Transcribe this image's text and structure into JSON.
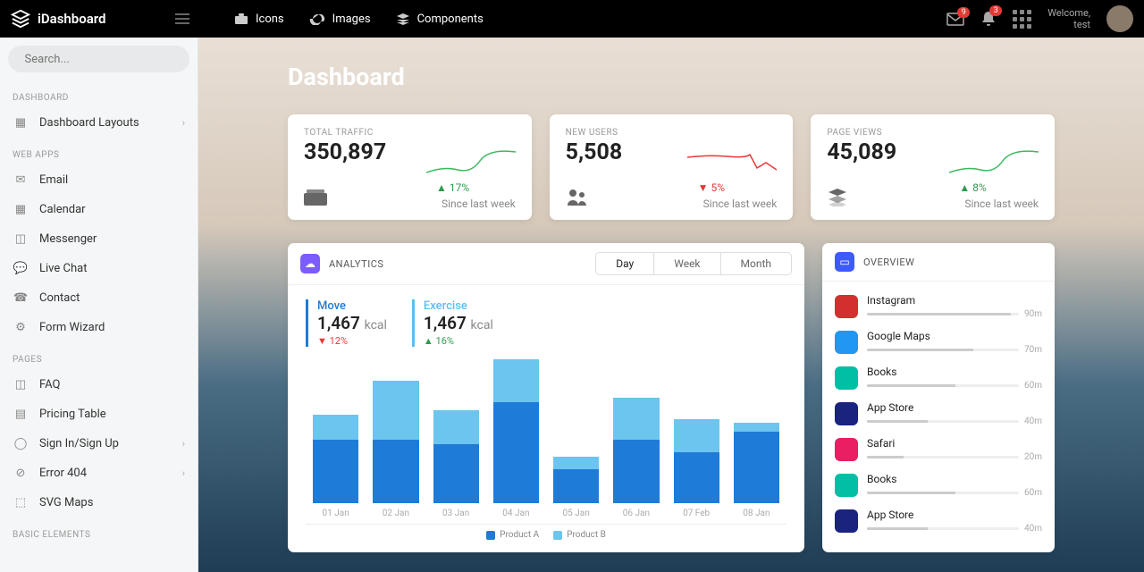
{
  "brand": "iDashboard",
  "topnav": {
    "icons": "Icons",
    "images": "Images",
    "components": "Components"
  },
  "badges": {
    "mail": "9",
    "bell": "3"
  },
  "welcome": {
    "line1": "Welcome,",
    "line2": "test"
  },
  "search": {
    "placeholder": "Search..."
  },
  "sidebar": {
    "sections": {
      "dashboard": "DASHBOARD",
      "webapps": "WEB APPS",
      "pages": "PAGES",
      "basic": "BASIC ELEMENTS"
    },
    "items": {
      "layouts": "Dashboard Layouts",
      "email": "Email",
      "calendar": "Calendar",
      "messenger": "Messenger",
      "livechat": "Live Chat",
      "contact": "Contact",
      "formwizard": "Form Wizard",
      "faq": "FAQ",
      "pricing": "Pricing Table",
      "sign": "Sign In/Sign Up",
      "error": "Error 404",
      "svgmaps": "SVG Maps"
    }
  },
  "page_title": "Dashboard",
  "stats": [
    {
      "label": "TOTAL TRAFFIC",
      "value": "350,897",
      "change": "17%",
      "dir": "up",
      "since": "Since last week"
    },
    {
      "label": "NEW USERS",
      "value": "5,508",
      "change": "5%",
      "dir": "down",
      "since": "Since last week"
    },
    {
      "label": "PAGE VIEWS",
      "value": "45,089",
      "change": "8%",
      "dir": "up",
      "since": "Since last week"
    }
  ],
  "analytics": {
    "title": "ANALYTICS",
    "tabs": [
      "Day",
      "Week",
      "Month"
    ],
    "metrics": [
      {
        "label": "Move",
        "value": "1,467",
        "unit": "kcal",
        "change": "12%",
        "dir": "down"
      },
      {
        "label": "Exercise",
        "value": "1,467",
        "unit": "kcal",
        "change": "16%",
        "dir": "up"
      }
    ],
    "legend": [
      "Product A",
      "Product B"
    ]
  },
  "chart_data": {
    "type": "bar",
    "categories": [
      "01 Jan",
      "02 Jan",
      "03 Jan",
      "04 Jan",
      "05 Jan",
      "06 Jan",
      "07 Feb",
      "08 Jan"
    ],
    "series": [
      {
        "name": "Product A",
        "values": [
          75,
          75,
          70,
          120,
          40,
          75,
          60,
          85
        ]
      },
      {
        "name": "Product B",
        "values": [
          30,
          70,
          40,
          50,
          15,
          50,
          40,
          10
        ]
      }
    ],
    "ylim": [
      0,
      180
    ]
  },
  "overview": {
    "title": "OVERVIEW",
    "items": [
      {
        "name": "Instagram",
        "time": "90m",
        "pct": 95,
        "color": "#d32f2f"
      },
      {
        "name": "Google Maps",
        "time": "70m",
        "pct": 70,
        "color": "#2196f3"
      },
      {
        "name": "Books",
        "time": "60m",
        "pct": 58,
        "color": "#00bfa5"
      },
      {
        "name": "App Store",
        "time": "40m",
        "pct": 40,
        "color": "#1a237e"
      },
      {
        "name": "Safari",
        "time": "20m",
        "pct": 24,
        "color": "#e91e63"
      },
      {
        "name": "Books",
        "time": "60m",
        "pct": 58,
        "color": "#00bfa5"
      },
      {
        "name": "App Store",
        "time": "40m",
        "pct": 40,
        "color": "#1a237e"
      }
    ]
  }
}
